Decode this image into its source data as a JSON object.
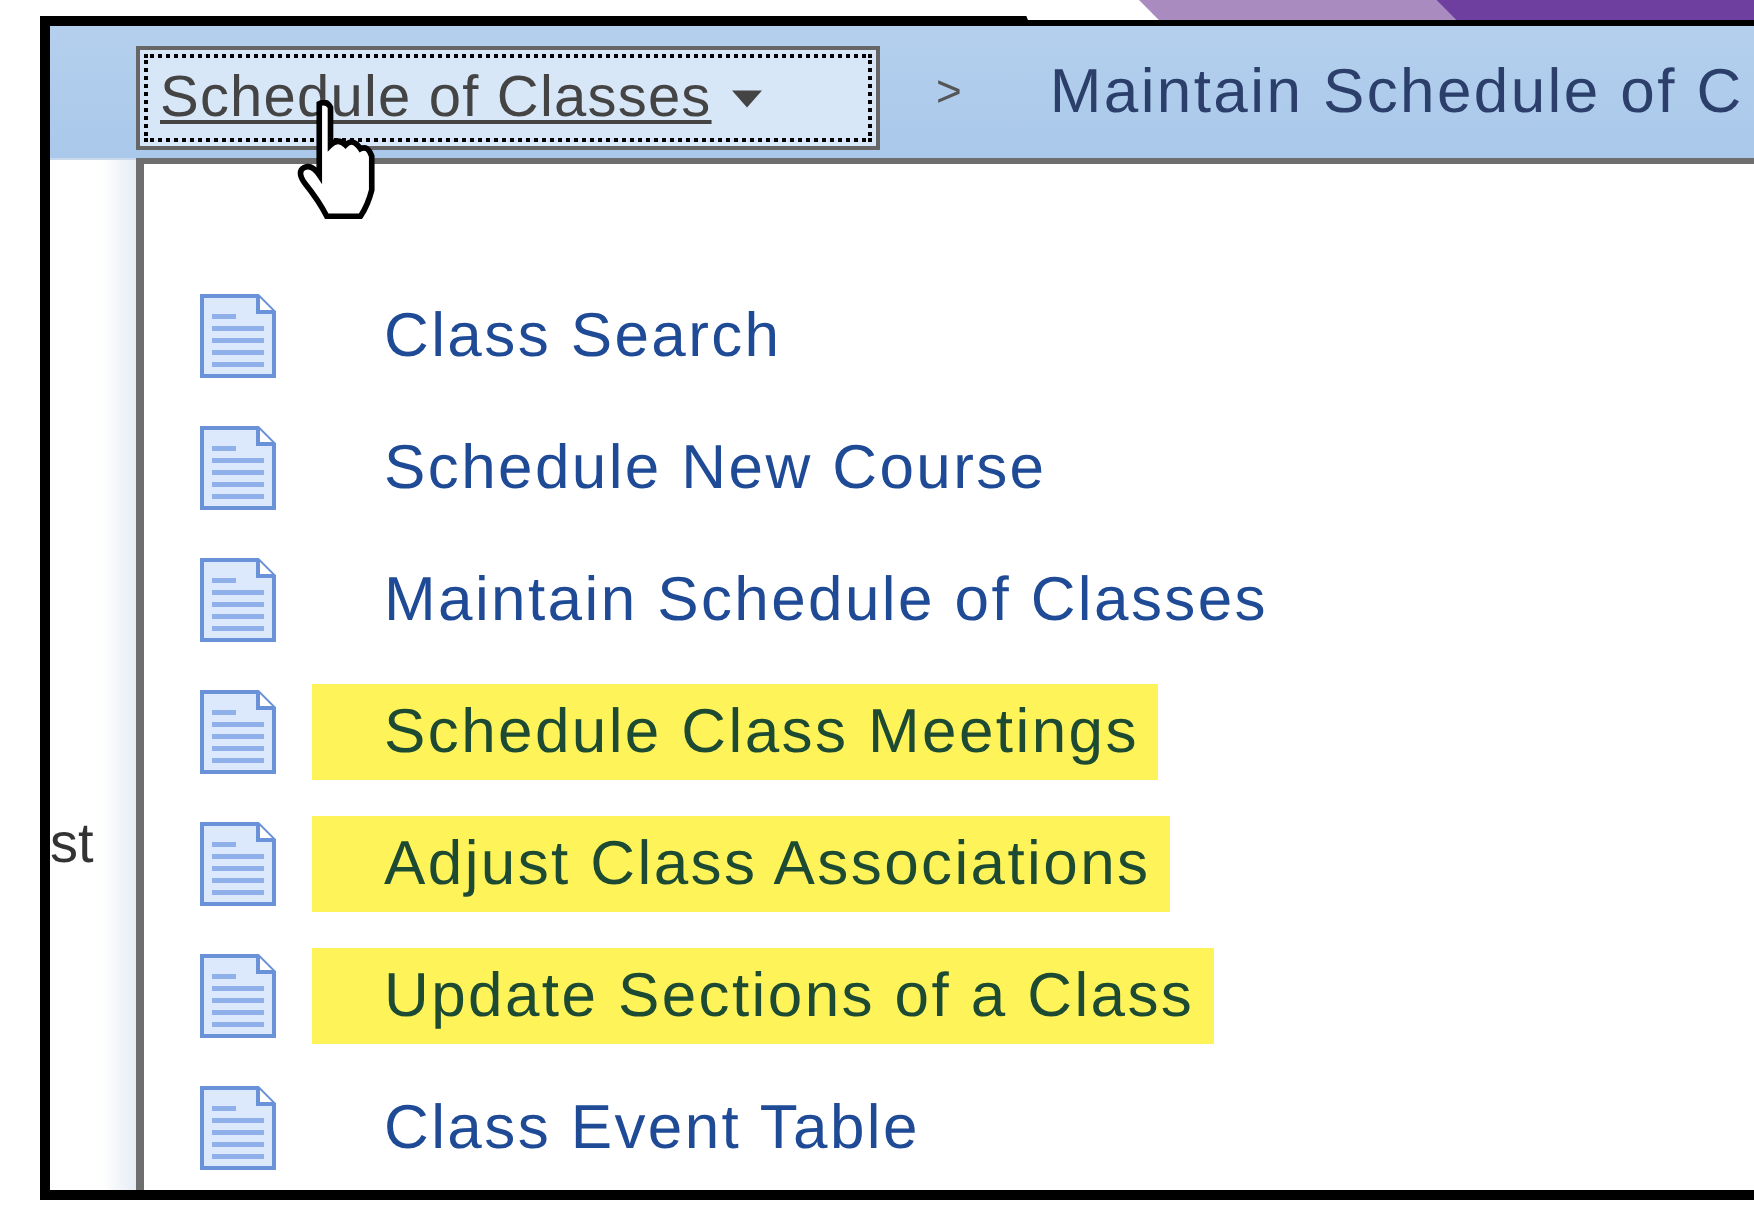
{
  "breadcrumb": {
    "menu_button": {
      "label": "Schedule of Classes",
      "expanded": true
    },
    "separator": ">",
    "current": "Maintain Schedule of C"
  },
  "side_text": "st",
  "menu_items": [
    {
      "label": "Class Search",
      "highlighted": false
    },
    {
      "label": "Schedule New Course",
      "highlighted": false
    },
    {
      "label": "Maintain Schedule of Classes",
      "highlighted": false
    },
    {
      "label": "Schedule Class Meetings",
      "highlighted": true
    },
    {
      "label": "Adjust Class Associations",
      "highlighted": true
    },
    {
      "label": "Update Sections of a Class",
      "highlighted": true
    },
    {
      "label": "Class Event Table",
      "highlighted": false
    }
  ]
}
